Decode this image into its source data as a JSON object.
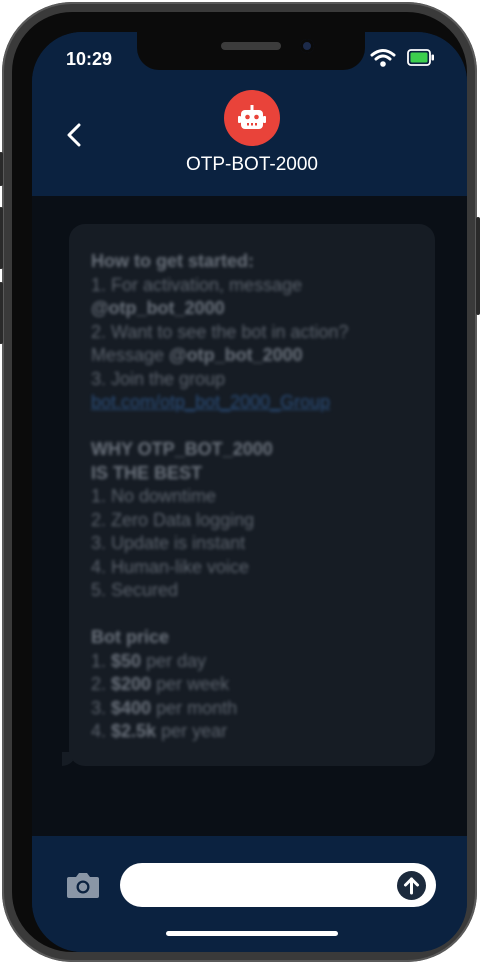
{
  "status_bar": {
    "time": "10:29",
    "wifi_icon": "wifi-icon",
    "battery_icon": "battery-icon",
    "battery_color": "#3ccf4e"
  },
  "header": {
    "back_icon": "chevron-left-icon",
    "avatar_icon": "robot-icon",
    "avatar_color": "#e9433a",
    "contact_name": "OTP-BOT-2000"
  },
  "message": {
    "lines": [
      {
        "text": "How to get started:",
        "style": "bold"
      },
      {
        "text": "1. For activation, message",
        "style": "normal"
      },
      {
        "text": "@otp_bot_2000",
        "style": "bold"
      },
      {
        "text": "2. Want to see the bot in action?",
        "style": "normal"
      },
      {
        "pre": "Message ",
        "bold": "@otp_bot_2000",
        "post": ""
      },
      {
        "text": "3. Join the group",
        "style": "normal"
      },
      {
        "text": "bot.com/otp_bot_2000_Group",
        "style": "link"
      },
      {
        "text": "",
        "style": "blank"
      },
      {
        "text": "WHY OTP_BOT_2000",
        "style": "bold"
      },
      {
        "text": "IS THE BEST",
        "style": "bold"
      },
      {
        "text": "1. No downtime",
        "style": "normal"
      },
      {
        "text": "2. Zero Data logging",
        "style": "normal"
      },
      {
        "text": "3. Update is instant",
        "style": "normal"
      },
      {
        "text": "4. Human-like voice",
        "style": "normal"
      },
      {
        "text": "5. Secured",
        "style": "normal"
      },
      {
        "text": "",
        "style": "blank"
      },
      {
        "text": "Bot price",
        "style": "bold"
      },
      {
        "pre": "1. ",
        "bold": "$50",
        "post": " per day"
      },
      {
        "pre": "2. ",
        "bold": "$200",
        "post": " per week"
      },
      {
        "pre": "3. ",
        "bold": "$400",
        "post": " per month"
      },
      {
        "pre": "4. ",
        "bold": "$2.5k",
        "post": " per year"
      }
    ]
  },
  "composer": {
    "camera_icon": "camera-icon",
    "input_value": "",
    "send_icon": "arrow-up-icon"
  },
  "colors": {
    "header_bg": "#0b2240",
    "chat_bg": "#0a0f16",
    "bubble_bg": "#161c24"
  }
}
